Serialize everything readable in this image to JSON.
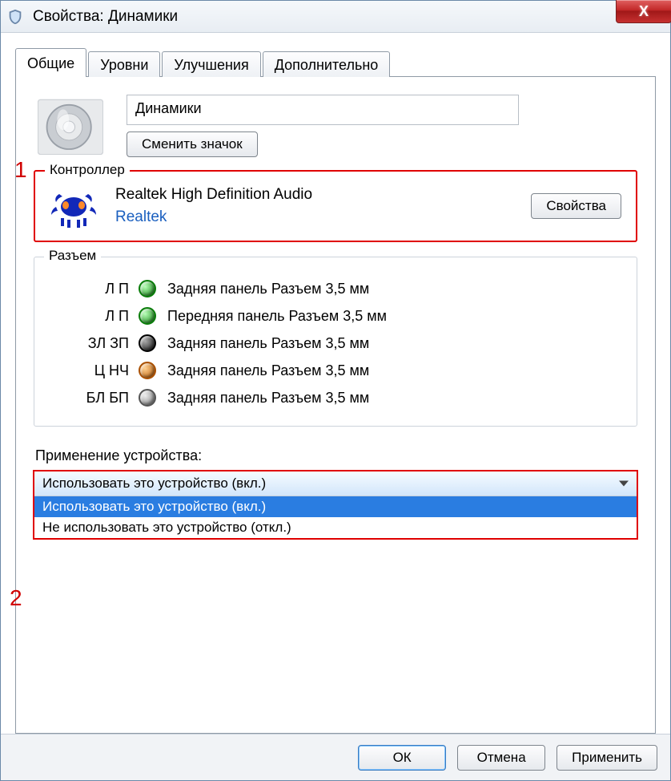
{
  "window": {
    "title": "Свойства: Динамики"
  },
  "tabs": {
    "general": "Общие",
    "levels": "Уровни",
    "enhancements": "Улучшения",
    "advanced": "Дополнительно"
  },
  "device": {
    "name": "Динамики",
    "change_icon": "Сменить значок"
  },
  "annotations": {
    "one": "1",
    "two": "2"
  },
  "controller": {
    "legend": "Контроллер",
    "name": "Realtek High Definition Audio",
    "vendor": "Realtek",
    "props_btn": "Свойства"
  },
  "jacks": {
    "legend": "Разъем",
    "items": [
      {
        "ch": "Л П",
        "color": "green",
        "desc": "Задняя панель Разъем 3,5 мм"
      },
      {
        "ch": "Л П",
        "color": "green",
        "desc": "Передняя панель Разъем 3,5 мм"
      },
      {
        "ch": "ЗЛ ЗП",
        "color": "black",
        "desc": "Задняя панель Разъем 3,5 мм"
      },
      {
        "ch": "Ц НЧ",
        "color": "orange",
        "desc": "Задняя панель Разъем 3,5 мм"
      },
      {
        "ch": "БЛ БП",
        "color": "grey",
        "desc": "Задняя панель Разъем 3,5 мм"
      }
    ]
  },
  "usage": {
    "label": "Применение устройства:",
    "selected": "Использовать это устройство (вкл.)",
    "options": [
      "Использовать это устройство (вкл.)",
      "Не использовать это устройство (откл.)"
    ]
  },
  "footer": {
    "ok": "ОК",
    "cancel": "Отмена",
    "apply": "Применить"
  }
}
